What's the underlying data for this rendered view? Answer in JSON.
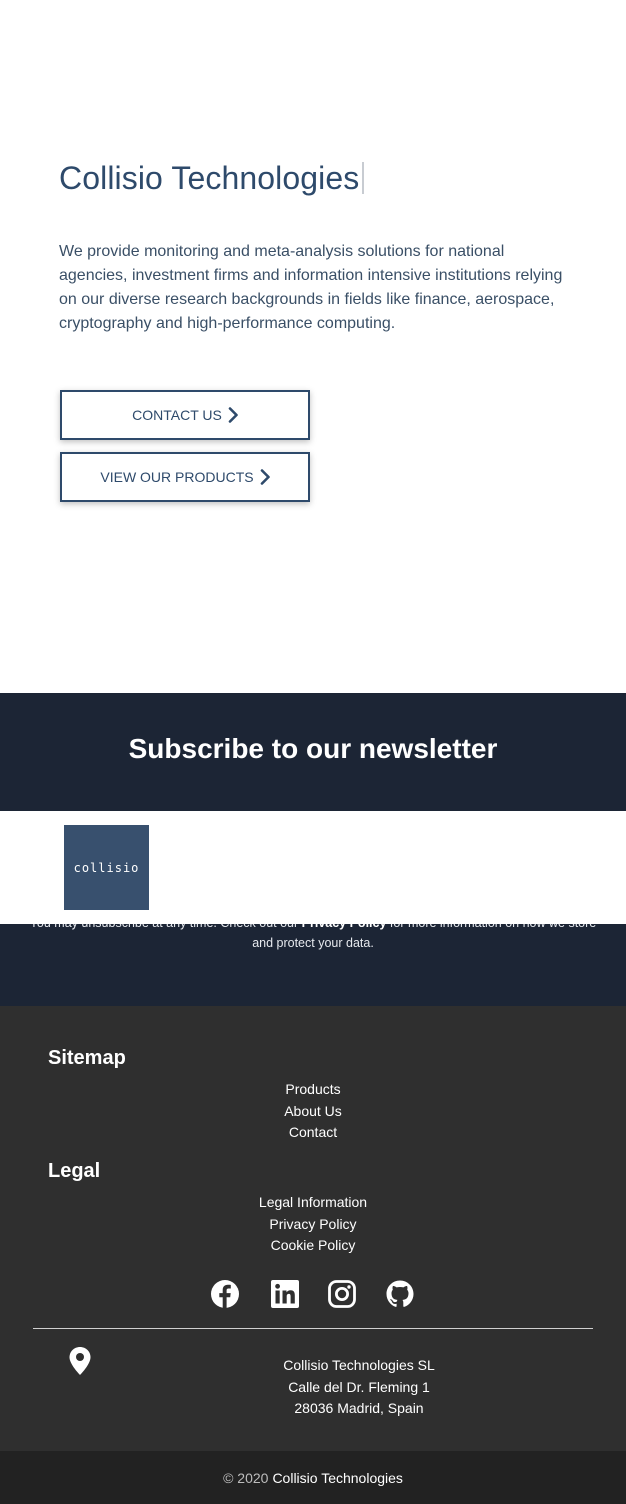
{
  "hero": {
    "title": "Collisio Technologies",
    "description": "We provide monitoring and meta-analysis solutions for national agencies, investment firms and information intensive institutions relying on our diverse research backgrounds in fields like finance, aerospace, cryptography and high-performance computing.",
    "buttons": {
      "contact": "CONTACT US",
      "products": "VIEW OUR PRODUCTS"
    }
  },
  "newsletter": {
    "title": "Subscribe to our newsletter",
    "logo_text": "collisio",
    "note_before": "You may unsubscribe at any time. Check out our ",
    "note_link": "Privacy Policy",
    "note_after": " for more information on how we store and protect your data."
  },
  "footer": {
    "sitemap_title": "Sitemap",
    "sitemap_links": [
      "Products",
      "About Us",
      "Contact"
    ],
    "legal_title": "Legal",
    "legal_links": [
      "Legal Information",
      "Privacy Policy",
      "Cookie Policy"
    ],
    "social_icons": [
      "facebook-icon",
      "linkedin-icon",
      "instagram-icon",
      "github-icon"
    ],
    "address": {
      "company": "Collisio Technologies SL",
      "street": "Calle del Dr. Fleming 1",
      "city": "28036 Madrid, Spain"
    },
    "copyright_prefix": "© 2020",
    "copyright_name": "Collisio Technologies"
  },
  "colors": {
    "brand_blue": "#2e4a6b",
    "newsletter_bg": "#1c2535",
    "footer_bg": "#2f2f2f",
    "copyright_bg": "#222222"
  }
}
